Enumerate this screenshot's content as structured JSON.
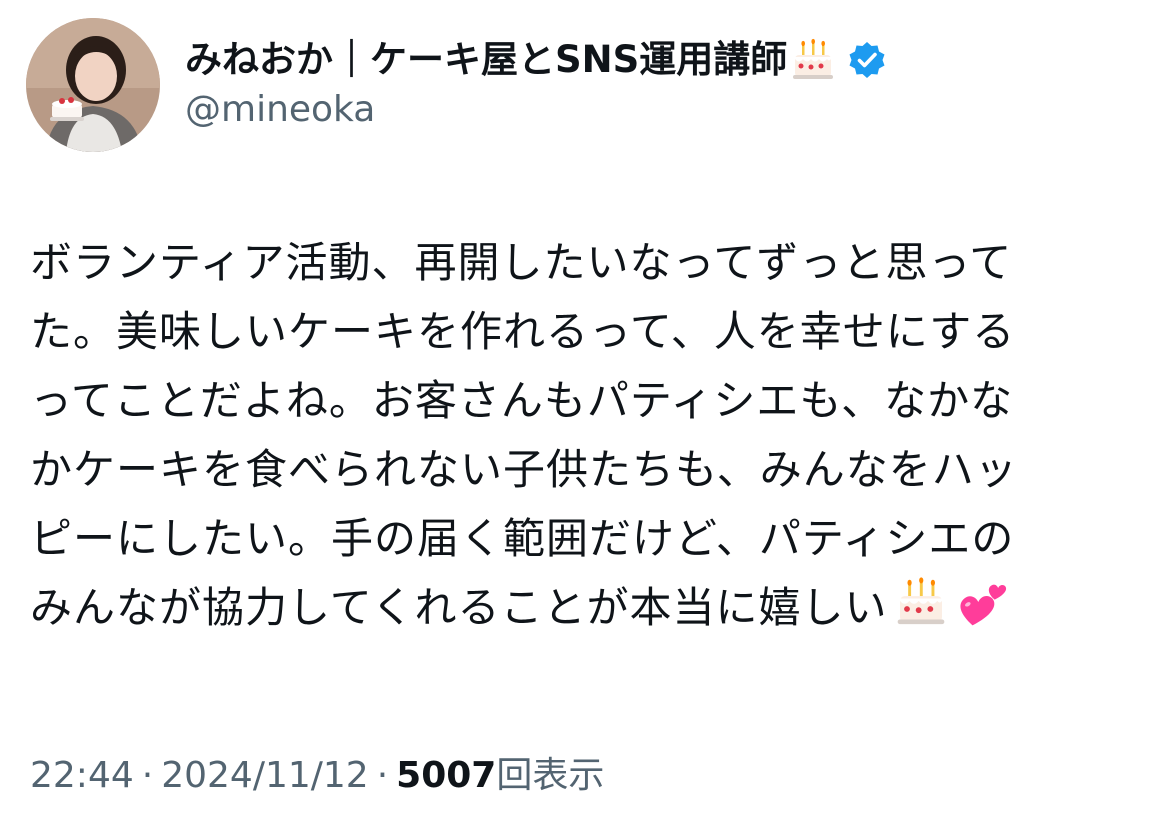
{
  "author": {
    "display_name": "みねおか｜ケーキ屋とSNS運用講師",
    "name_emoji": "birthday-cake-icon",
    "verified": true,
    "verified_icon": "verified-badge-icon",
    "handle": "@mineoka"
  },
  "tweet": {
    "lines": [
      "ボランティア活動、再開したいなってずっと思って",
      "た。美味しいケーキを作れるって、人を幸せにする",
      "ってことだよね。お客さんもパティシエも、なかな",
      "かケーキを食べられない子供たちも、みんなをハッ",
      "ピーにしたい。手の届く範囲だけど、パティシエの",
      "みんなが協力してくれることが本当に嬉しい"
    ],
    "trailing_emojis": [
      "birthday-cake-icon",
      "two-hearts-icon"
    ]
  },
  "meta": {
    "time": "22:44",
    "separator": "·",
    "date": "2024/11/12",
    "views_count": "5007",
    "views_label": "回表示"
  },
  "colors": {
    "text": "#0f1419",
    "secondary": "#536471",
    "verified": "#1d9bf0",
    "heart": "#ff3d9a"
  }
}
